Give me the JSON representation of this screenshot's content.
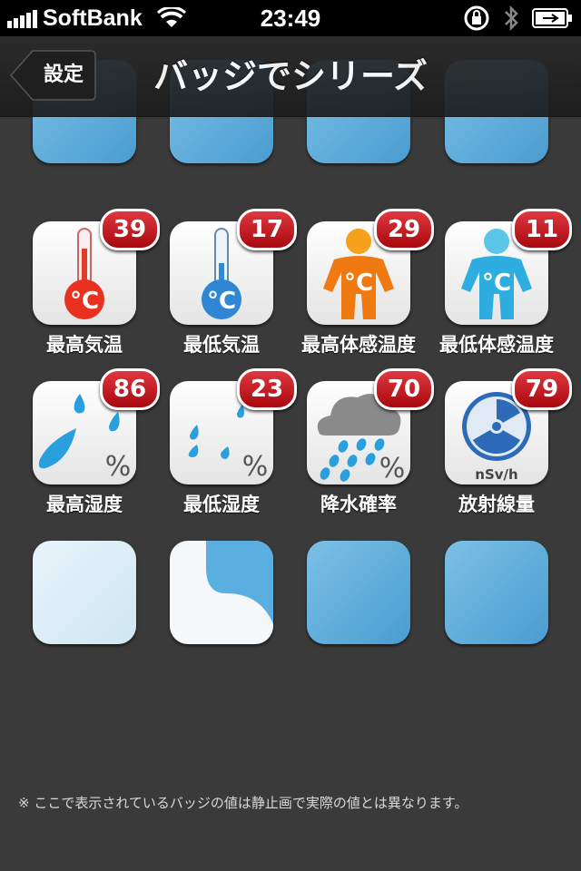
{
  "status_bar": {
    "carrier": "SoftBank",
    "time": "23:49",
    "icons": [
      "signal-icon",
      "wifi-icon",
      "rotation-lock-icon",
      "bluetooth-icon",
      "battery-icon"
    ]
  },
  "nav": {
    "back_label": "設定",
    "title": "バッジでシリーズ"
  },
  "items": [
    {
      "label": "最高気温",
      "badge": "39",
      "icon": "thermometer-hot-icon"
    },
    {
      "label": "最低気温",
      "badge": "17",
      "icon": "thermometer-cold-icon"
    },
    {
      "label": "最高体感温度",
      "badge": "29",
      "icon": "person-warm-icon"
    },
    {
      "label": "最低体感温度",
      "badge": "11",
      "icon": "person-cold-icon"
    },
    {
      "label": "最高湿度",
      "badge": "86",
      "icon": "humidity-high-icon"
    },
    {
      "label": "最低湿度",
      "badge": "23",
      "icon": "humidity-low-icon"
    },
    {
      "label": "降水確率",
      "badge": "70",
      "icon": "rain-cloud-icon"
    },
    {
      "label": "放射線量",
      "badge": "79",
      "icon": "radiation-icon"
    }
  ],
  "icon_text": {
    "celsius": "°C",
    "percent": "%",
    "radiation_unit": "nSv/h"
  },
  "footnote": "※ ここで表示されているバッジの値は静止画で実際の値とは異なります。",
  "colors": {
    "badge": "#c8141c",
    "tile_blue": "#5aaee0",
    "background": "#3a3a3a"
  }
}
